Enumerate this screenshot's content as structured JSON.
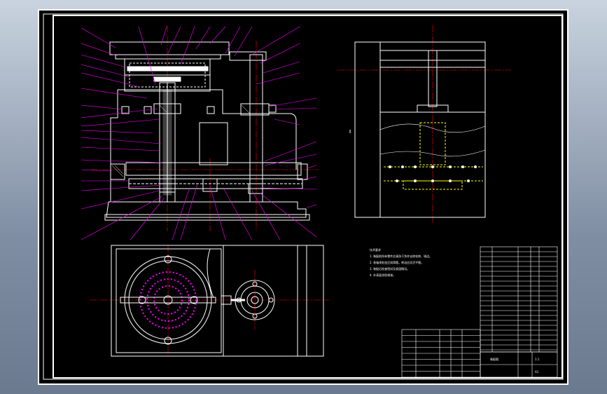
{
  "viewer": {
    "background_colors": [
      "#c9d3df",
      "#6b7a8f"
    ]
  },
  "drawing": {
    "line_color": "#ffffff",
    "leader_color": "#ff00ff",
    "centerline_color": "#ff0000",
    "hidden_line_color": "#ffff00",
    "background_color": "#000000"
  },
  "notes": {
    "lines": [
      "技术要求",
      "1. 装配前所有零件应清洗干净并去除毛刺、锐边。",
      "2. 各轴承处加注润滑脂，转动应灵活平稳。",
      "3. 装配后检查密封及紧固情况。",
      "4. 外表面涂防锈漆。"
    ]
  },
  "title_block": {
    "drawing_title": "装配图",
    "scale": "1:1",
    "sheet": "A1"
  }
}
